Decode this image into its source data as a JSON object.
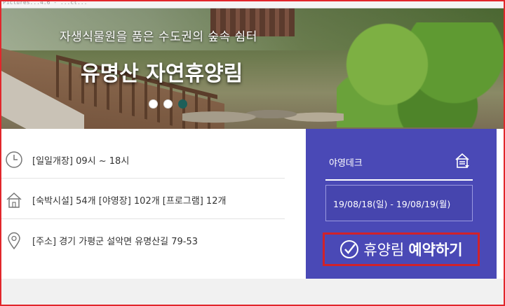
{
  "browser": {
    "tab_fragment": "Pictures...4.6 - ...ct..."
  },
  "hero": {
    "subtitle": "자생식물원을 품은 수도권의 숲속 쉼터",
    "title": "유명산 자연휴양림",
    "slides_count": 3,
    "active_slide": 3
  },
  "info": {
    "hours": "[일일개장] 09시 ~ 18시",
    "facilities": "[숙박시설] 54개 [야영장] 102개 [프로그램] 12개",
    "address": "[주소] 경기 가평군 설악면 유명산길 79-53"
  },
  "reserve": {
    "category": "야영데크",
    "date_range": "19/08/18(일) - 19/08/19(월)",
    "button_label_regular": "휴양림",
    "button_label_bold": "예약하기"
  },
  "colors": {
    "reserve_bg": "#4a49b6",
    "highlight_border": "#d1222a",
    "active_dot": "#1d5f59"
  }
}
